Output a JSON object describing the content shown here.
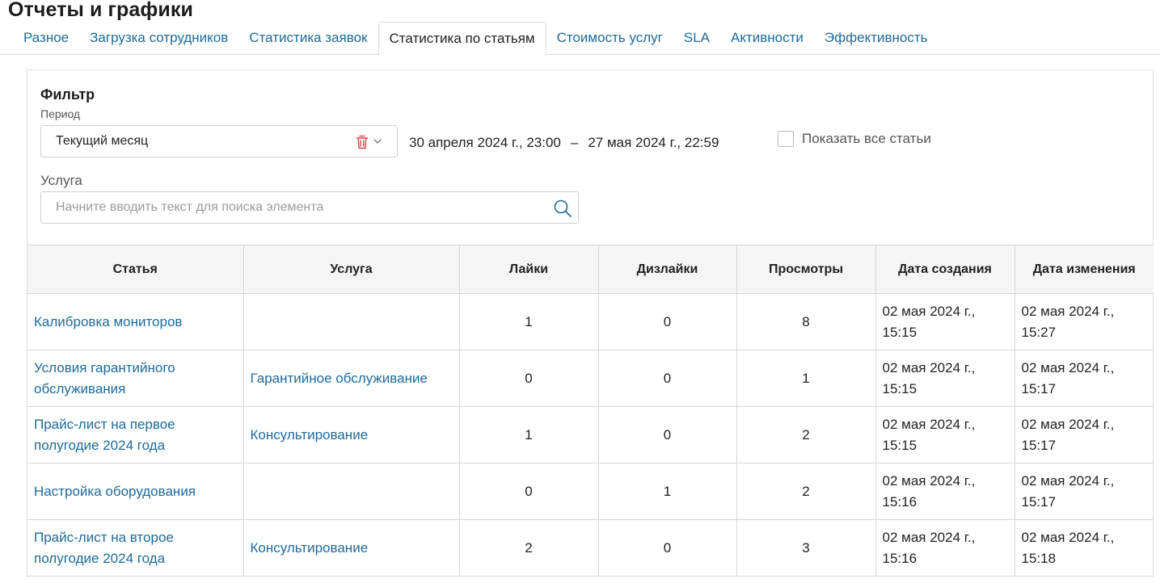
{
  "page": {
    "title": "Отчеты и графики"
  },
  "tabs": [
    {
      "label": "Разное"
    },
    {
      "label": "Загрузка сотрудников"
    },
    {
      "label": "Статистика заявок"
    },
    {
      "label": "Статистика по статьям",
      "active": true
    },
    {
      "label": "Стоимость услуг"
    },
    {
      "label": "SLA"
    },
    {
      "label": "Активности"
    },
    {
      "label": "Эффективность"
    }
  ],
  "filter": {
    "title": "Фильтр",
    "period_label": "Период",
    "period_value": "Текущий месяц",
    "date_from": "30 апреля 2024 г., 23:00",
    "date_separator": "–",
    "date_to": "27 мая 2024 г., 22:59",
    "show_all_label": "Показать все статьи",
    "show_all_checked": false,
    "service_label": "Услуга",
    "service_placeholder": "Начните вводить текст для поиска элемента",
    "service_value": ""
  },
  "colors": {
    "link": "#1d6a9c",
    "trash": "#e0454b",
    "header_bg": "#f5f5f5"
  },
  "icons": [
    "trash-icon",
    "chevron-down-icon",
    "checkbox",
    "search-icon"
  ],
  "table": {
    "columns": [
      "Статья",
      "Услуга",
      "Лайки",
      "Дизлайки",
      "Просмотры",
      "Дата создания",
      "Дата изменения"
    ],
    "rows": [
      {
        "article": "Калибровка мониторов",
        "service": "",
        "likes": "1",
        "dislikes": "0",
        "views": "8",
        "created": "02 мая 2024 г., 15:15",
        "modified": "02 мая 2024 г., 15:27"
      },
      {
        "article": "Условия гарантийного обслуживания",
        "service": "Гарантийное обслуживание",
        "likes": "0",
        "dislikes": "0",
        "views": "1",
        "created": "02 мая 2024 г., 15:15",
        "modified": "02 мая 2024 г., 15:17"
      },
      {
        "article": "Прайс-лист на первое полугодие 2024 года",
        "service": "Консультирование",
        "likes": "1",
        "dislikes": "0",
        "views": "2",
        "created": "02 мая 2024 г., 15:15",
        "modified": "02 мая 2024 г., 15:17"
      },
      {
        "article": "Настройка оборудования",
        "service": "",
        "likes": "0",
        "dislikes": "1",
        "views": "2",
        "created": "02 мая 2024 г., 15:16",
        "modified": "02 мая 2024 г., 15:17"
      },
      {
        "article": "Прайс-лист на второе полугодие 2024 года",
        "service": "Консультирование",
        "likes": "2",
        "dislikes": "0",
        "views": "3",
        "created": "02 мая 2024 г., 15:16",
        "modified": "02 мая 2024 г., 15:18"
      }
    ]
  }
}
